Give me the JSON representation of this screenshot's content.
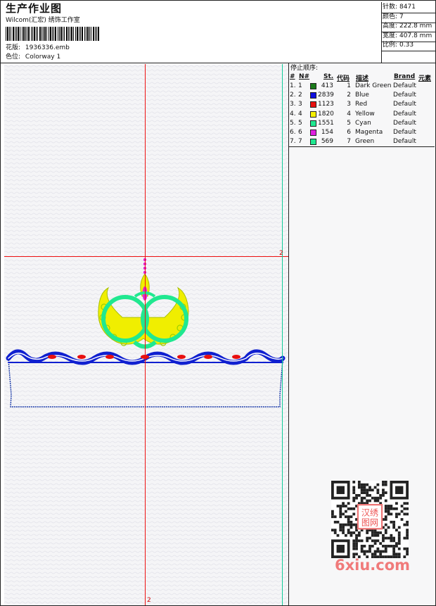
{
  "header": {
    "title": "生产作业图",
    "subtitle": "Wilcom(汇宏) 绣饰工作室",
    "design_label": "花版:",
    "design_value": "1936336.emb",
    "colorway_label": "色位:",
    "colorway_value": "Colorway 1"
  },
  "info": [
    {
      "label": "针数:",
      "value": "8471"
    },
    {
      "label": "颜色:",
      "value": "7"
    },
    {
      "label": "高度:",
      "value": "222.8 mm"
    },
    {
      "label": "宽度:",
      "value": "407.8 mm"
    },
    {
      "label": "比例:",
      "value": "0.33"
    }
  ],
  "stop_sequence": {
    "label": "停止顺序:",
    "columns": [
      "#",
      "N#",
      "St.",
      "代码",
      "描述",
      "Brand",
      "元素"
    ],
    "rows": [
      {
        "num": "1.",
        "n": "1",
        "stitches": "413",
        "code": "1",
        "desc": "Dark Green",
        "brand": "Default",
        "color": "#1a7a1a"
      },
      {
        "num": "2.",
        "n": "2",
        "stitches": "2839",
        "code": "2",
        "desc": "Blue",
        "brand": "Default",
        "color": "#1010e0"
      },
      {
        "num": "3.",
        "n": "3",
        "stitches": "1123",
        "code": "3",
        "desc": "Red",
        "brand": "Default",
        "color": "#e81010"
      },
      {
        "num": "4.",
        "n": "4",
        "stitches": "1820",
        "code": "4",
        "desc": "Yellow",
        "brand": "Default",
        "color": "#f5f000"
      },
      {
        "num": "5.",
        "n": "5",
        "stitches": "1551",
        "code": "5",
        "desc": "Cyan",
        "brand": "Default",
        "color": "#20e890"
      },
      {
        "num": "6.",
        "n": "6",
        "stitches": "154",
        "code": "6",
        "desc": "Magenta",
        "brand": "Default",
        "color": "#e020e0"
      },
      {
        "num": "7.",
        "n": "7",
        "stitches": "569",
        "code": "7",
        "desc": "Green",
        "brand": "Default",
        "color": "#20e890"
      }
    ]
  },
  "canvas": {
    "axis_mark_right": "2",
    "axis_mark_bottom": "2"
  },
  "watermark": {
    "text": "6xiu.com",
    "stamp": "汉绣图网"
  }
}
